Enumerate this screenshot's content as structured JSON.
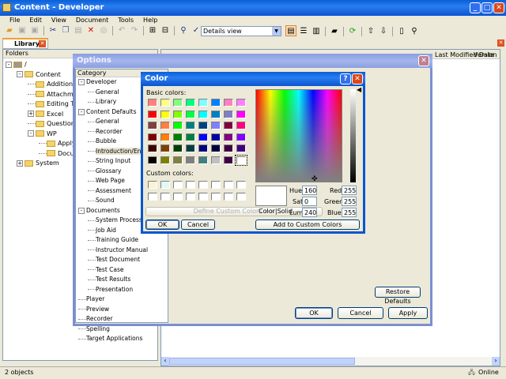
{
  "window": {
    "title": "Content - Developer"
  },
  "menu": [
    "File",
    "Edit",
    "View",
    "Document",
    "Tools",
    "Help"
  ],
  "toolbar": {
    "view_select": "Details view"
  },
  "tab": {
    "label": "Library"
  },
  "folders": {
    "header": "Folders",
    "items": [
      {
        "label": "/",
        "depth": 0,
        "pm": "-"
      },
      {
        "label": "Content",
        "depth": 1,
        "pm": "-"
      },
      {
        "label": "Additional Top",
        "depth": 2
      },
      {
        "label": "Attachments",
        "depth": 2
      },
      {
        "label": "Editing Techni",
        "depth": 2
      },
      {
        "label": "Excel",
        "depth": 2,
        "pm": "+"
      },
      {
        "label": "Questions and",
        "depth": 2
      },
      {
        "label": "WP",
        "depth": 2,
        "pm": "-"
      },
      {
        "label": "Applying F",
        "depth": 3
      },
      {
        "label": "Document",
        "depth": 3
      },
      {
        "label": "System",
        "depth": 1,
        "pm": "+"
      }
    ]
  },
  "list": {
    "columns": [
      "Last Modified Date",
      "Version"
    ]
  },
  "status": {
    "count": "2 objects",
    "online": "Online"
  },
  "options": {
    "title": "Options",
    "category_header": "Category",
    "restore": "Restore Defaults",
    "ok": "OK",
    "cancel": "Cancel",
    "apply": "Apply",
    "categories": [
      {
        "label": "Developer",
        "depth": 0,
        "pm": "-"
      },
      {
        "label": "General",
        "depth": 1
      },
      {
        "label": "Library",
        "depth": 1
      },
      {
        "label": "Content Defaults",
        "depth": 0,
        "pm": "-"
      },
      {
        "label": "General",
        "depth": 1
      },
      {
        "label": "Recorder",
        "depth": 1
      },
      {
        "label": "Bubble",
        "depth": 1
      },
      {
        "label": "Introduction/End Frame",
        "depth": 1,
        "sel": true
      },
      {
        "label": "String Input",
        "depth": 1
      },
      {
        "label": "Glossary",
        "depth": 1
      },
      {
        "label": "Web Page",
        "depth": 1
      },
      {
        "label": "Assessment",
        "depth": 1
      },
      {
        "label": "Sound",
        "depth": 1
      },
      {
        "label": "Documents",
        "depth": 0,
        "pm": "-"
      },
      {
        "label": "System Process",
        "depth": 1
      },
      {
        "label": "Job Aid",
        "depth": 1
      },
      {
        "label": "Training Guide",
        "depth": 1
      },
      {
        "label": "Instructor Manual",
        "depth": 1
      },
      {
        "label": "Test Document",
        "depth": 1
      },
      {
        "label": "Test Case",
        "depth": 1
      },
      {
        "label": "Test Results",
        "depth": 1
      },
      {
        "label": "Presentation",
        "depth": 1
      },
      {
        "label": "Player",
        "depth": 0
      },
      {
        "label": "Preview",
        "depth": 0
      },
      {
        "label": "Recorder",
        "depth": 0
      },
      {
        "label": "Spelling",
        "depth": 0
      },
      {
        "label": "Target Applications",
        "depth": 0
      }
    ]
  },
  "color": {
    "title": "Color",
    "basic_label": "Basic colors:",
    "custom_label": "Custom colors:",
    "define": "Define Custom Colors >>",
    "ok": "OK",
    "cancel": "Cancel",
    "colorsolid": "Color|Solid",
    "add": "Add to Custom Colors",
    "hue_label": "Hue:",
    "hue": "160",
    "sat_label": "Sat:",
    "sat": "0",
    "lum_label": "Lum:",
    "lum": "240",
    "red_label": "Red:",
    "red": "255",
    "green_label": "Green:",
    "green": "255",
    "blue_label": "Blue:",
    "blue": "255",
    "basic": [
      "#FF8080",
      "#FFFF80",
      "#80FF80",
      "#00FF80",
      "#80FFFF",
      "#0080FF",
      "#FF80C0",
      "#FF80FF",
      "#FF0000",
      "#FFFF00",
      "#80FF00",
      "#00FF40",
      "#00FFFF",
      "#0080C0",
      "#8080C0",
      "#FF00FF",
      "#804040",
      "#FF8040",
      "#00FF00",
      "#008080",
      "#004080",
      "#8080FF",
      "#800040",
      "#FF0080",
      "#800000",
      "#FF8000",
      "#008000",
      "#008040",
      "#0000FF",
      "#0000A0",
      "#800080",
      "#8000FF",
      "#400000",
      "#804000",
      "#004000",
      "#004040",
      "#000080",
      "#000040",
      "#400040",
      "#400080",
      "#000000",
      "#808000",
      "#808040",
      "#808080",
      "#408080",
      "#C0C0C0",
      "#400040",
      "#FFFFFF"
    ],
    "custom": [
      "#FBF1D5",
      "#E0F8F8",
      "#FFFFFF",
      "#FFFFFF",
      "#FFFFFF",
      "#FFFFFF",
      "#FFFFFF",
      "#FFFFFF",
      "#FFFFFF",
      "#FFFFFF",
      "#FFFFFF",
      "#FFFFFF",
      "#FFFFFF",
      "#FFFFFF",
      "#FFFFFF",
      "#FFFFFF"
    ],
    "current": "#FFFFFF"
  }
}
